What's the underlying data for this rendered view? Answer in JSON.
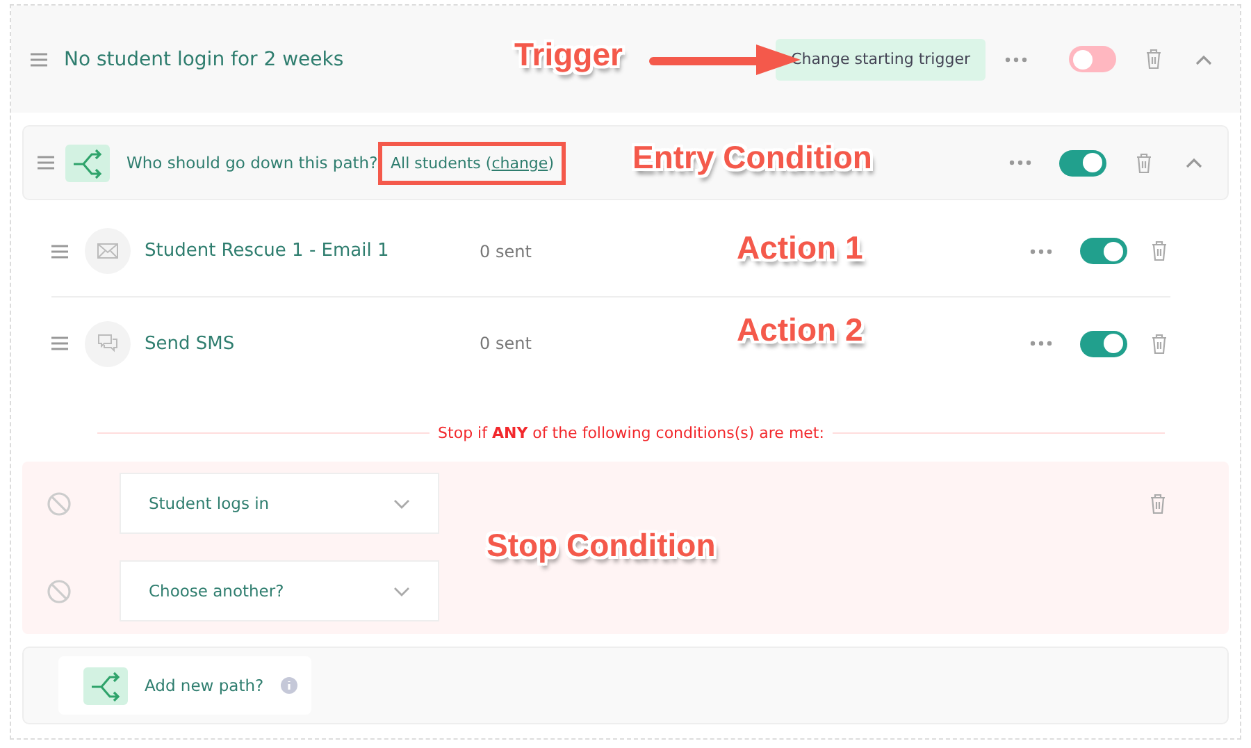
{
  "trigger": {
    "title": "No student login for 2 weeks",
    "button": "Change starting trigger",
    "enabled": false,
    "expanded": true
  },
  "path": {
    "question": "Who should go down this path?",
    "entry_prefix": "All students (",
    "entry_link": "change",
    "entry_suffix": ")",
    "enabled": true,
    "expanded": true,
    "actions": [
      {
        "kind": "email",
        "name": "Student Rescue 1 - Email 1",
        "sent": "0 sent",
        "enabled": true
      },
      {
        "kind": "sms",
        "name": "Send SMS",
        "sent": "0 sent",
        "enabled": true
      }
    ],
    "stop_text": "Stop if **ANY** of the following conditions(s) are met:",
    "stop_conditions": [
      {
        "label": "Student logs in"
      },
      {
        "label": "Choose another?"
      }
    ]
  },
  "add_path": {
    "label": "Add new path?"
  },
  "annotations": [
    {
      "text": "Trigger"
    },
    {
      "text": "Entry Condition"
    },
    {
      "text": "Action 1"
    },
    {
      "text": "Action 2"
    },
    {
      "text": "Stop Condition"
    }
  ]
}
